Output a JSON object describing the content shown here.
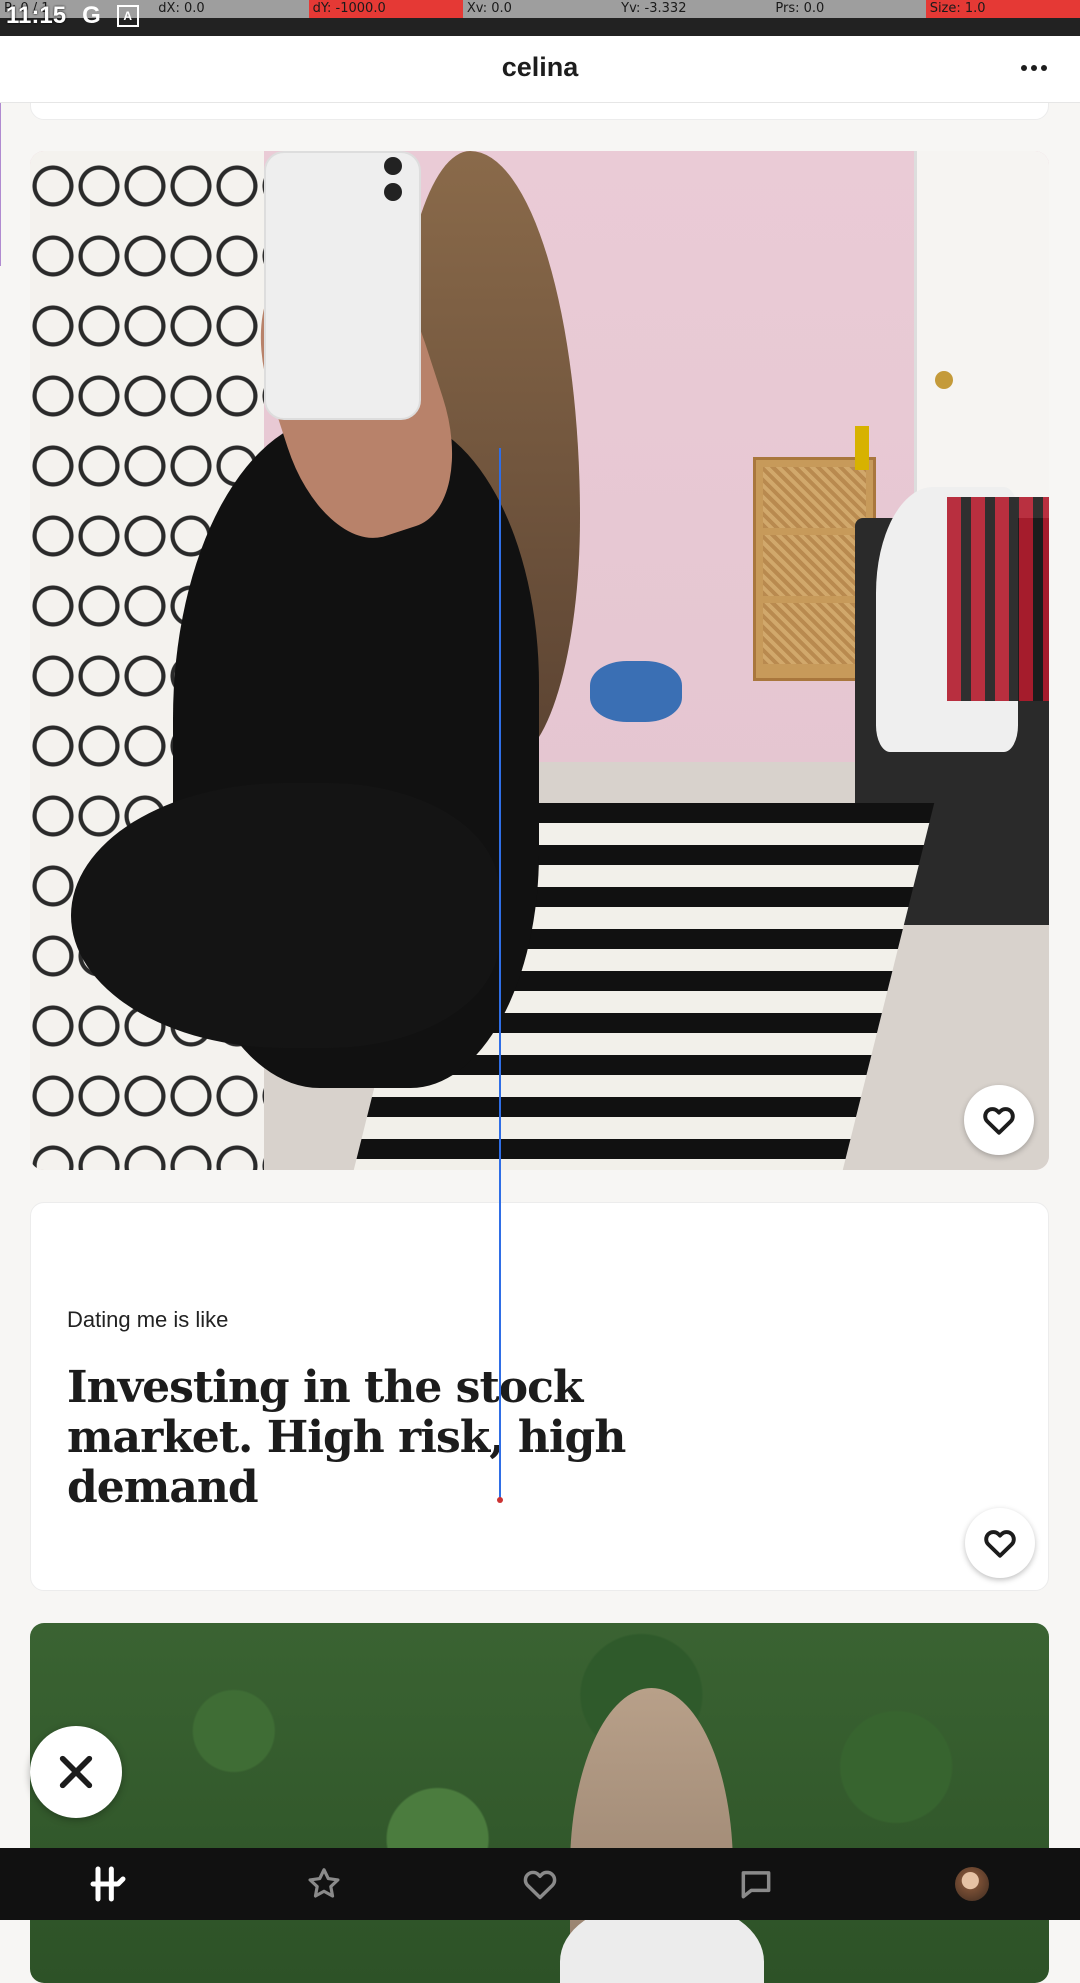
{
  "debug_bar": {
    "cells": [
      {
        "text": "P: 0 / 1",
        "highlight": false
      },
      {
        "text": "dX: 0.0",
        "highlight": false
      },
      {
        "text": "dY: -1000.0",
        "highlight": true
      },
      {
        "text": "Xv: 0.0",
        "highlight": false
      },
      {
        "text": "Yv: -3.332",
        "highlight": false
      },
      {
        "text": "Prs: 0.0",
        "highlight": false
      },
      {
        "text": "Size: 1.0",
        "highlight": true
      }
    ]
  },
  "status_bar": {
    "time": "11:15",
    "icons": [
      "google-icon",
      "font-icon"
    ]
  },
  "header": {
    "title": "celina",
    "more_icon": "more-horizontal-icon"
  },
  "prompt": {
    "label": "Dating me is like",
    "answer": "Investing in the stock market. High risk, high demand"
  },
  "icons": {
    "like": "heart-icon",
    "skip": "close-icon"
  },
  "bottom_nav": {
    "items": [
      "home-icon",
      "star-icon",
      "heart-icon",
      "chat-icon",
      "profile-avatar"
    ]
  },
  "colors": {
    "header_bg": "#ffffff",
    "page_bg": "#f7f6f4",
    "nav_bg": "#111111",
    "debug_red": "#e53935",
    "debug_gray": "#9e9e9e",
    "gesture_line": "#2f6ee6"
  }
}
